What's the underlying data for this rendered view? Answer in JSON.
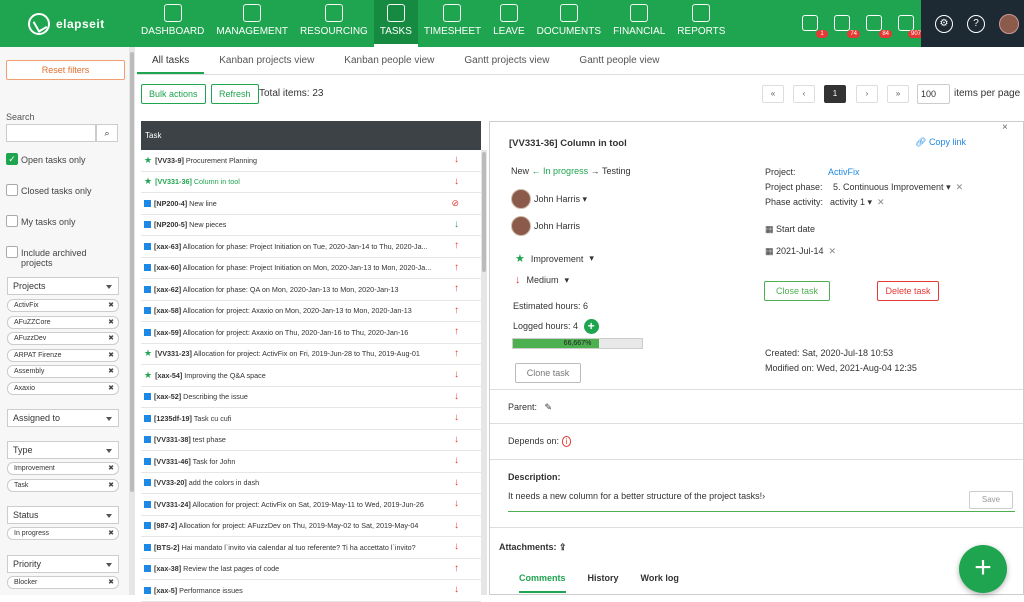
{
  "app": {
    "name": "elapseit"
  },
  "nav": [
    {
      "label": "DASHBOARD",
      "icon": "dashboard-icon"
    },
    {
      "label": "MANAGEMENT",
      "icon": "globe-icon"
    },
    {
      "label": "RESOURCING",
      "icon": "people-icon"
    },
    {
      "label": "TASKS",
      "icon": "tasks-icon",
      "active": true
    },
    {
      "label": "TIMESHEET",
      "icon": "stopwatch-icon"
    },
    {
      "label": "LEAVE",
      "icon": "calendar-icon"
    },
    {
      "label": "DOCUMENTS",
      "icon": "document-icon"
    },
    {
      "label": "FINANCIAL",
      "icon": "wallet-icon"
    },
    {
      "label": "REPORTS",
      "icon": "chart-icon"
    }
  ],
  "notifications": [
    {
      "icon": "resource-request-icon",
      "count": "1"
    },
    {
      "icon": "timer-icon",
      "count": "74"
    },
    {
      "icon": "calendar-icon",
      "count": "84"
    },
    {
      "icon": "hourglass-icon",
      "count": "907"
    }
  ],
  "sidebar": {
    "reset_label": "Reset filters",
    "search_label": "Search",
    "search_value": "",
    "checks": [
      {
        "label": "Open tasks only",
        "checked": true
      },
      {
        "label": "Closed tasks only",
        "checked": false
      },
      {
        "label": "My tasks only",
        "checked": false
      },
      {
        "label": "Include archived projects",
        "checked": false
      }
    ],
    "projects_label": "Projects",
    "projects": [
      "ActivFix",
      "AFuZZCore",
      "AFuzzDev",
      "ARPAT Firenze",
      "Assembly",
      "Axaxio"
    ],
    "assigned_label": "Assigned to",
    "type_label": "Type",
    "types": [
      "Improvement",
      "Task"
    ],
    "status_label": "Status",
    "statuses": [
      "In progress"
    ],
    "priority_label": "Priority",
    "priorities": [
      "Blocker"
    ]
  },
  "tabs": [
    "All tasks",
    "Kanban projects view",
    "Kanban people view",
    "Gantt projects view",
    "Gantt people view"
  ],
  "toolbar": {
    "bulk_label": "Bulk actions",
    "refresh_label": "Refresh",
    "total_label": "Total items: 23",
    "page_first": "«",
    "page_prev": "‹",
    "page_current": "1",
    "page_next": "›",
    "page_last": "»",
    "per_page": "100",
    "per_page_label": "items per page"
  },
  "table": {
    "header": "Task",
    "rows": [
      {
        "type": "story",
        "id": "[VV33-9]",
        "title": "Procurement Planning",
        "priority": "down"
      },
      {
        "type": "story",
        "id": "[VV331-36]",
        "title": "Column in tool",
        "priority": "down",
        "selected": true
      },
      {
        "type": "task",
        "id": "[NP200-4]",
        "title": "New line",
        "priority": "blocker"
      },
      {
        "type": "task",
        "id": "[NP200-5]",
        "title": "New pieces",
        "priority": "green-down"
      },
      {
        "type": "task",
        "id": "[xax-63]",
        "title": "Allocation for phase: Project Initiation on Tue, 2020-Jan-14 to Thu, 2020-Ja...",
        "priority": "up"
      },
      {
        "type": "task",
        "id": "[xax-60]",
        "title": "Allocation for phase: Project Initiation on Mon, 2020-Jan-13 to Mon, 2020-Ja...",
        "priority": "up"
      },
      {
        "type": "task",
        "id": "[xax-62]",
        "title": "Allocation for phase: QA on Mon, 2020-Jan-13 to Mon, 2020-Jan-13",
        "priority": "up"
      },
      {
        "type": "task",
        "id": "[xax-58]",
        "title": "Allocation for project: Axaxio on Mon, 2020-Jan-13 to Mon, 2020-Jan-13",
        "priority": "up"
      },
      {
        "type": "task",
        "id": "[xax-59]",
        "title": "Allocation for project: Axaxio on Thu, 2020-Jan-16 to Thu, 2020-Jan-16",
        "priority": "up"
      },
      {
        "type": "story",
        "id": "[VV331-23]",
        "title": "Allocation for project: ActivFix on Fri, 2019-Jun-28 to Thu, 2019-Aug-01",
        "priority": "up"
      },
      {
        "type": "story",
        "id": "[xax-54]",
        "title": "Improving the Q&A space",
        "priority": "down"
      },
      {
        "type": "task",
        "id": "[xax-52]",
        "title": "Describing the issue",
        "priority": "down"
      },
      {
        "type": "task",
        "id": "[1235df-19]",
        "title": "Task cu cufi",
        "priority": "down"
      },
      {
        "type": "task",
        "id": "[VV331-38]",
        "title": "test phase",
        "priority": "down"
      },
      {
        "type": "task",
        "id": "[VV331-46]",
        "title": "Task for John",
        "priority": "down"
      },
      {
        "type": "task",
        "id": "[VV33-20]",
        "title": "add the colors in dash",
        "priority": "down"
      },
      {
        "type": "task",
        "id": "[VV331-24]",
        "title": "Allocation for project: ActivFix on Sat, 2019-May-11 to Wed, 2019-Jun-26",
        "priority": "down"
      },
      {
        "type": "task",
        "id": "[987-2]",
        "title": "Allocation for project: AFuzzDev on Thu, 2019-May-02 to Sat, 2019-May-04",
        "priority": "down"
      },
      {
        "type": "task",
        "id": "[BTS-2]",
        "title": "Hai mandato l`invito via calendar al tuo referente? Ti ha accettato l`invito?",
        "priority": "down"
      },
      {
        "type": "task",
        "id": "[xax-38]",
        "title": "Review the last pages of code",
        "priority": "up"
      },
      {
        "type": "task",
        "id": "[xax-5]",
        "title": "Performance issues",
        "priority": "down"
      }
    ]
  },
  "detail": {
    "title": "[VV331-36]  Column in tool",
    "copy_link": "Copy link",
    "close": "×",
    "workflow_prev": "New",
    "workflow_current": "In progress",
    "workflow_next": "Testing",
    "assignee1": "John Harris",
    "assignee2": "John Harris",
    "type": "Improvement",
    "priority": "Medium",
    "estimated": "Estimated hours: 6",
    "logged": "Logged hours: 4",
    "progress_text": "66,667%",
    "progress_value": 0.667,
    "clone_label": "Clone task",
    "project_label": "Project:",
    "project_value": "ActivFix",
    "phase_label": "Project phase:",
    "phase_value": "5. Continuous Improvement",
    "activity_label": "Phase activity:",
    "activity_value": "activity 1",
    "start_date": "Start date",
    "due_date": "2021-Jul-14",
    "close_task": "Close task",
    "delete_task": "Delete task",
    "created": "Created: Sat, 2020-Jul-18 10:53",
    "modified": "Modified on: Wed, 2021-Aug-04 12:35",
    "parent_label": "Parent:",
    "depends_label": "Depends on:",
    "description_label": "Description:",
    "description_value": "It needs a new column for a better structure of the project tasks!›",
    "save_label": "Save",
    "attachments_label": "Attachments:",
    "tab_comments": "Comments",
    "tab_history": "History",
    "tab_worklog": "Work log"
  },
  "fab_label": "+"
}
